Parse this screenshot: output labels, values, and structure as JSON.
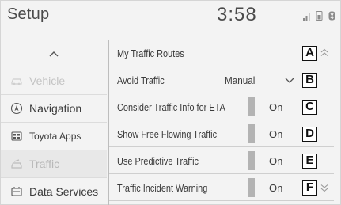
{
  "header": {
    "title": "Setup",
    "clock": "3:58",
    "status_icons": [
      "signal-icon",
      "phone-battery-icon",
      "bluetooth-icon"
    ]
  },
  "sidebar": {
    "items": [
      {
        "label": "Vehicle",
        "icon": "car-icon",
        "state": "dim"
      },
      {
        "label": "Navigation",
        "icon": "navigation-icon",
        "state": "normal"
      },
      {
        "label": "Toyota Apps",
        "icon": "apps-icon",
        "state": "normal"
      },
      {
        "label": "Traffic",
        "icon": "traffic-icon",
        "state": "selected"
      },
      {
        "label": "Data Services",
        "icon": "data-services-icon",
        "state": "normal"
      }
    ]
  },
  "list": {
    "rows": [
      {
        "label": "My Traffic Routes",
        "badge": "A"
      },
      {
        "label": "Avoid Traffic",
        "value": "Manual",
        "badge": "B"
      },
      {
        "label": "Consider Traffic Info for ETA",
        "value": "On",
        "badge": "C"
      },
      {
        "label": "Show Free Flowing Traffic",
        "value": "On",
        "badge": "D"
      },
      {
        "label": "Use Predictive Traffic",
        "value": "On",
        "badge": "E"
      },
      {
        "label": "Traffic Incident Warning",
        "value": "On",
        "badge": "F"
      }
    ]
  },
  "colors": {
    "background": "#f3f3f3",
    "selected_row": "#e8e8e8",
    "toggle_bar": "#b3b3b3",
    "dim_text": "#c4c4c4"
  }
}
